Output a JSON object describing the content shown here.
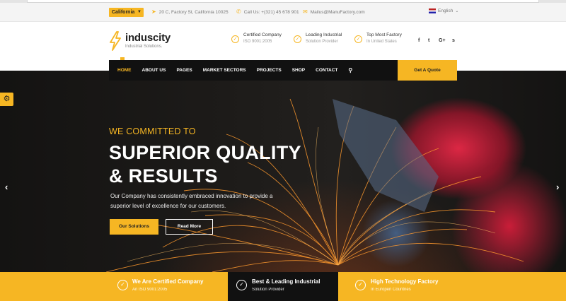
{
  "topbar": {
    "location_select": "California",
    "address": "20 C, Factory St, California 10025",
    "phone": "Call Us: +(321) 45 678 901",
    "email": "Mailus@ManuFactory.com",
    "language": "English"
  },
  "brand": {
    "name": "induscity",
    "tagline": "Industrial Solutions."
  },
  "header_features": [
    {
      "title": "Certified Company",
      "subtitle": "ISO 9001:2005",
      "icon": "check-circle-icon"
    },
    {
      "title": "Leading Industrial",
      "subtitle": "Solution Provider",
      "icon": "check-circle-icon"
    },
    {
      "title": "Top Most Factory",
      "subtitle": "In United States",
      "icon": "check-circle-icon"
    }
  ],
  "social": {
    "facebook": "f",
    "twitter": "t",
    "google": "G+",
    "skype": "s"
  },
  "nav": {
    "items": [
      "HOME",
      "ABOUT US",
      "PAGES",
      "MARKET SECTORS",
      "PROJECTS",
      "SHOP",
      "CONTACT"
    ],
    "active": "HOME",
    "quote_button": "Get A Quote"
  },
  "hero": {
    "subheading": "WE COMMITTED TO",
    "heading_line1": "SUPERIOR QUALITY",
    "heading_line2": "& RESULTS",
    "text": "Our Company has consistently embraced innovation to provide a superior level of excellence for our customers.",
    "primary_button": "Our Solutions",
    "secondary_button": "Read More"
  },
  "features_strip": [
    {
      "title": "We Are Certified Company",
      "subtitle": "An ISO 9001:2005"
    },
    {
      "title": "Best & Leading Industrial",
      "subtitle": "Solution Provider"
    },
    {
      "title": "High Technology Factory",
      "subtitle": "In Europen Countries"
    }
  ],
  "colors": {
    "accent": "#f6b623",
    "dark": "#111111"
  }
}
